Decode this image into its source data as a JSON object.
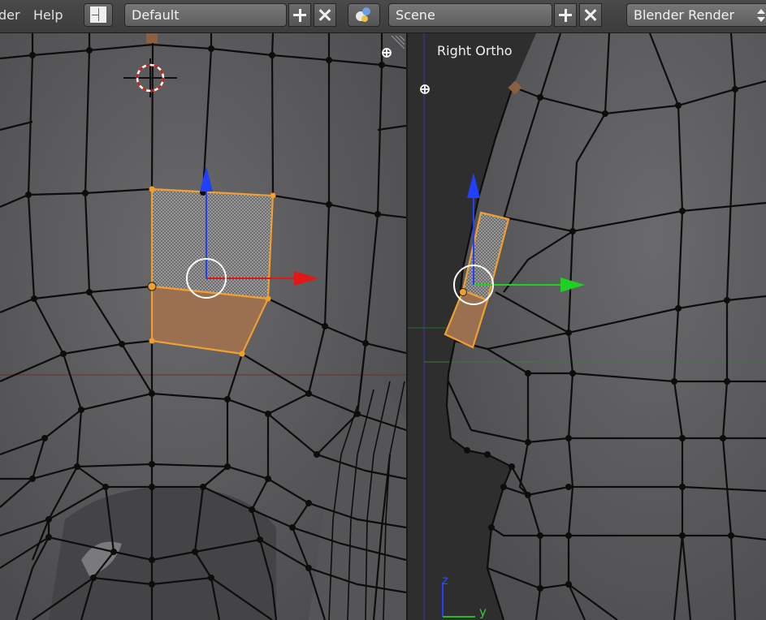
{
  "header": {
    "menus": [
      "der",
      "Help"
    ],
    "screen_layout": {
      "value": "Default"
    },
    "scene": {
      "value": "Scene"
    },
    "render_engine": {
      "value": "Blender Render"
    }
  },
  "viewports": {
    "left": {
      "label": ""
    },
    "right": {
      "label": "Right Ortho",
      "axis_labels": [
        "z",
        "y"
      ]
    }
  },
  "colors": {
    "selection": "#f0a030",
    "x_axis": "#e01818",
    "y_axis": "#20d020",
    "z_axis": "#2040ff",
    "mesh": "#5e5e60",
    "wire": "#0c0c0c"
  }
}
